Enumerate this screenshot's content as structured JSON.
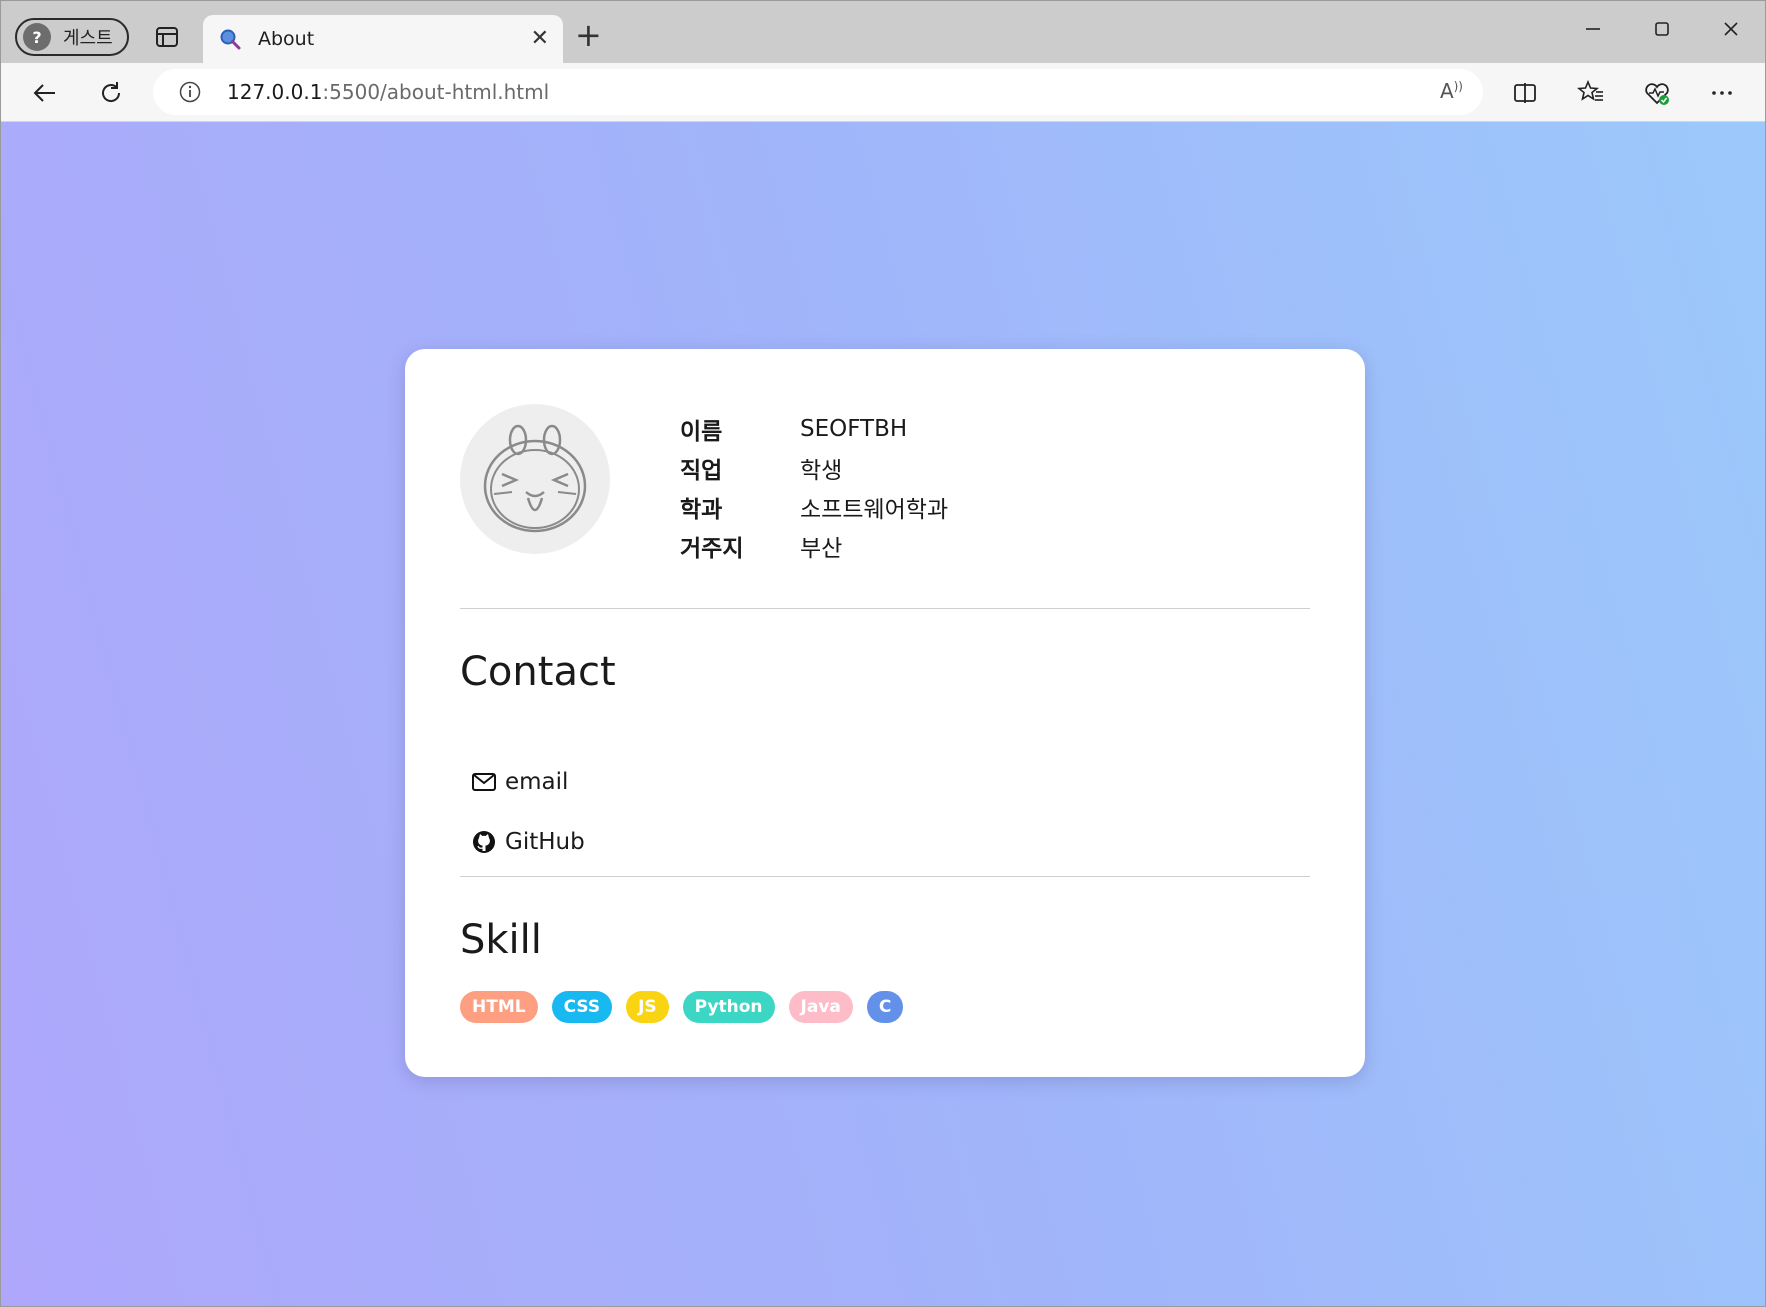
{
  "browser": {
    "profile_label": "게스트",
    "tab_title": "About",
    "url_host": "127.0.0.1",
    "url_rest": ":5500/about-html.html"
  },
  "profile": {
    "rows": [
      {
        "key": "이름",
        "value": "SEOFTBH"
      },
      {
        "key": "직업",
        "value": "학생"
      },
      {
        "key": "학과",
        "value": "소프트웨어학과"
      },
      {
        "key": "거주지",
        "value": "부산"
      }
    ]
  },
  "contact": {
    "title": "Contact",
    "email_label": "email",
    "github_label": "GitHub"
  },
  "skill": {
    "title": "Skill",
    "items": [
      {
        "label": "HTML",
        "color": "#fd9f80"
      },
      {
        "label": "CSS",
        "color": "#18b8f1"
      },
      {
        "label": "JS",
        "color": "#f9d412"
      },
      {
        "label": "Python",
        "color": "#3cd6c4"
      },
      {
        "label": "Java",
        "color": "#fdbcc8"
      },
      {
        "label": "C",
        "color": "#6391ea"
      }
    ]
  },
  "colors": {
    "background_start": "#aea7fb",
    "background_end": "#9cc9fb",
    "card": "#ffffff"
  }
}
